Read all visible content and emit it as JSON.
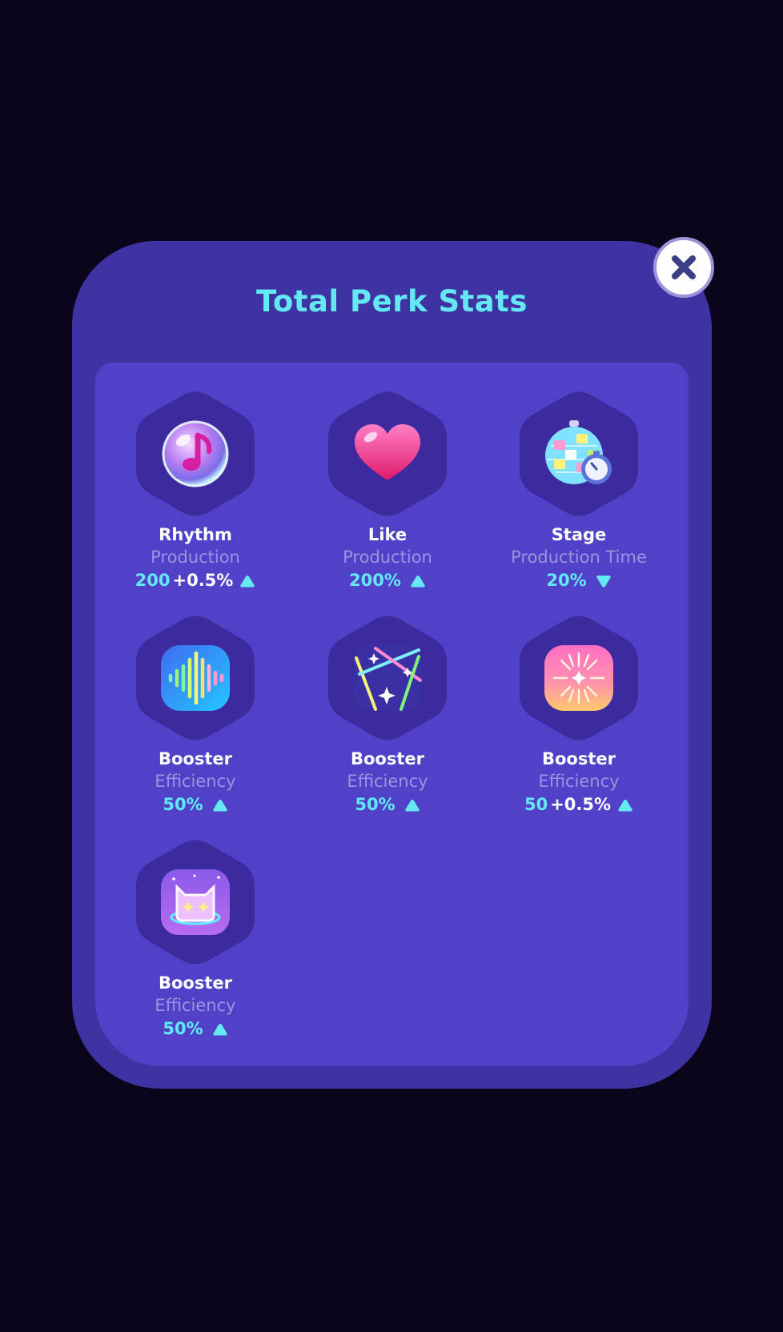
{
  "modal": {
    "title": "Total Perk Stats"
  },
  "close_icon": "close-x-icon",
  "colors": {
    "background": "#0b051c",
    "modal": "#3f33a3",
    "panel": "#5141c9",
    "hex": "#3d2a9e",
    "title": "#63e8f4",
    "value": "#63e8f4",
    "label": "#9b92e0"
  },
  "perks": [
    {
      "icon": "music-bubble-icon",
      "name": "Rhythm",
      "stat": "Production",
      "value": "200",
      "bonus": "+0.5%",
      "direction": "up"
    },
    {
      "icon": "heart-icon",
      "name": "Like",
      "stat": "Production",
      "value": "200%",
      "bonus": "",
      "direction": "up"
    },
    {
      "icon": "disco-ball-timer-icon",
      "name": "Stage",
      "stat": "Production Time",
      "value": "20%",
      "bonus": "",
      "direction": "down"
    },
    {
      "icon": "sound-wave-icon",
      "name": "Booster",
      "stat": "Efficiency",
      "value": "50%",
      "bonus": "",
      "direction": "up"
    },
    {
      "icon": "laser-lights-icon",
      "name": "Booster",
      "stat": "Efficiency",
      "value": "50%",
      "bonus": "",
      "direction": "up"
    },
    {
      "icon": "fireworks-icon",
      "name": "Booster",
      "stat": "Efficiency",
      "value": "50",
      "bonus": "+0.5%",
      "direction": "up"
    },
    {
      "icon": "neon-cat-icon",
      "name": "Booster",
      "stat": "Efficiency",
      "value": "50%",
      "bonus": "",
      "direction": "up"
    }
  ]
}
